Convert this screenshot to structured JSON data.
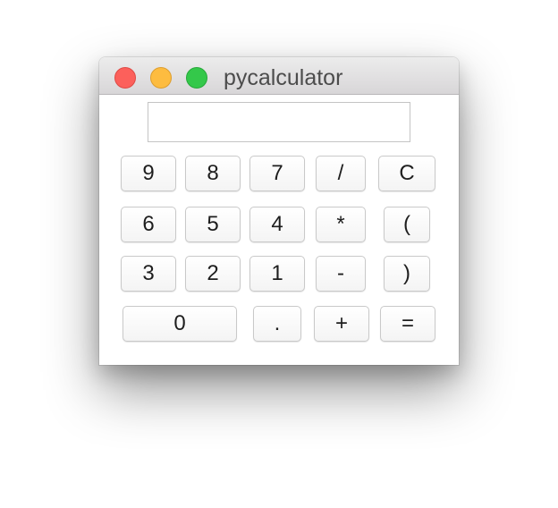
{
  "window": {
    "title": "pycalculator"
  },
  "display": {
    "value": ""
  },
  "keys": [
    {
      "label": "9",
      "name": "key-9"
    },
    {
      "label": "8",
      "name": "key-8"
    },
    {
      "label": "7",
      "name": "key-7"
    },
    {
      "label": "/",
      "name": "key-divide"
    },
    {
      "label": "C",
      "name": "key-clear"
    },
    {
      "label": "6",
      "name": "key-6"
    },
    {
      "label": "5",
      "name": "key-5"
    },
    {
      "label": "4",
      "name": "key-4"
    },
    {
      "label": "*",
      "name": "key-multiply"
    },
    {
      "label": "(",
      "name": "key-open-paren"
    },
    {
      "label": "3",
      "name": "key-3"
    },
    {
      "label": "2",
      "name": "key-2"
    },
    {
      "label": "1",
      "name": "key-1"
    },
    {
      "label": "-",
      "name": "key-minus"
    },
    {
      "label": ")",
      "name": "key-close-paren"
    },
    {
      "label": "0",
      "name": "key-0"
    },
    {
      "label": ".",
      "name": "key-decimal"
    },
    {
      "label": "+",
      "name": "key-plus"
    },
    {
      "label": "=",
      "name": "key-equals"
    }
  ]
}
